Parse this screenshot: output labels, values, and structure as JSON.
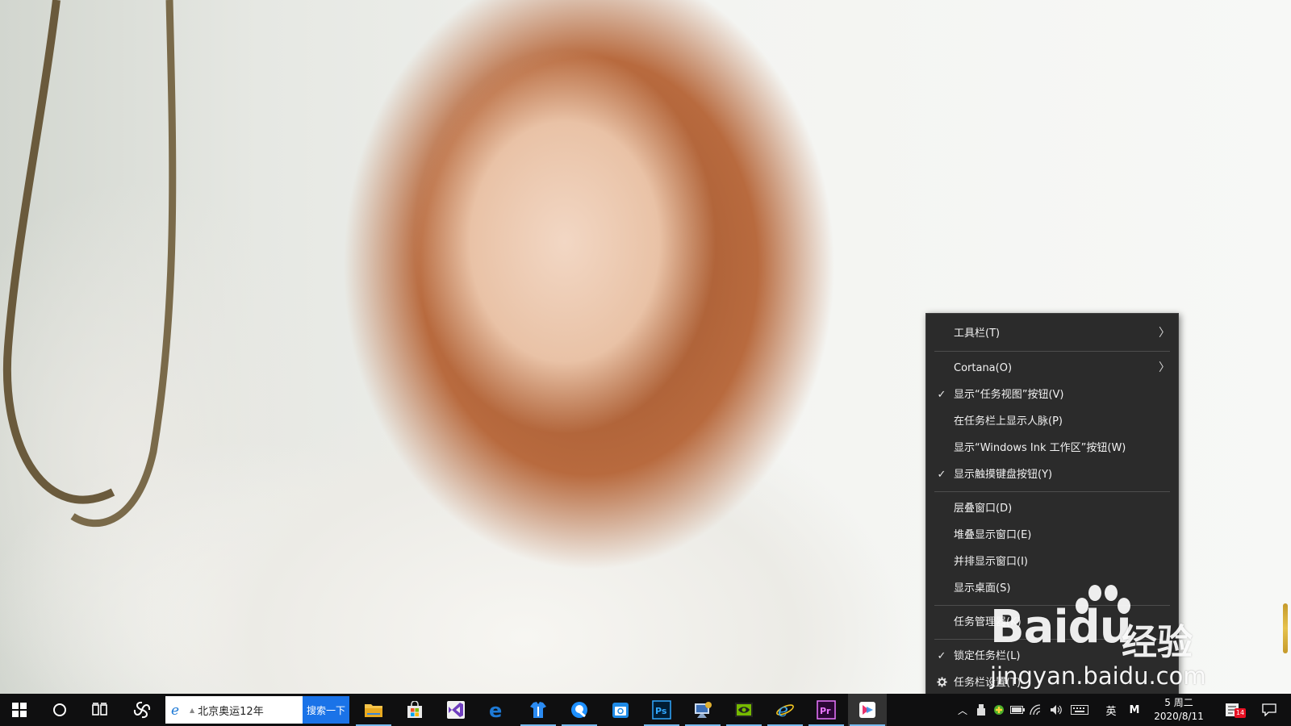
{
  "context_menu": {
    "items": [
      {
        "label": "工具栏(T)",
        "checked": false,
        "submenu": true
      },
      {
        "label": "Cortana(O)",
        "checked": false,
        "submenu": true
      },
      {
        "label": "显示“任务视图”按钮(V)",
        "checked": true,
        "submenu": false
      },
      {
        "label": "在任务栏上显示人脉(P)",
        "checked": false,
        "submenu": false
      },
      {
        "label": "显示“Windows Ink 工作区”按钮(W)",
        "checked": false,
        "submenu": false
      },
      {
        "label": "显示触摸键盘按钮(Y)",
        "checked": true,
        "submenu": false
      },
      {
        "label": "层叠窗口(D)",
        "checked": false,
        "submenu": false
      },
      {
        "label": "堆叠显示窗口(E)",
        "checked": false,
        "submenu": false
      },
      {
        "label": "并排显示窗口(I)",
        "checked": false,
        "submenu": false
      },
      {
        "label": "显示桌面(S)",
        "checked": false,
        "submenu": false
      },
      {
        "label": "任务管理器(K)",
        "checked": false,
        "submenu": false
      },
      {
        "label": "锁定任务栏(L)",
        "checked": true,
        "submenu": false
      },
      {
        "label": "任务栏设置(T)",
        "checked": false,
        "submenu": false,
        "icon": "gear-icon"
      }
    ],
    "check_glyph": "✓",
    "arrow_glyph": "〉"
  },
  "taskbar": {
    "search_text": "北京奥运12年",
    "search_button": "搜索一下",
    "tray": {
      "ime_language": "英",
      "ime_mode": "M",
      "time_fragment": "5 周二",
      "date": "2020/8/11",
      "notification_count": "14"
    },
    "apps": [
      {
        "name": "file-explorer-icon"
      },
      {
        "name": "store-icon"
      },
      {
        "name": "visual-studio-icon"
      },
      {
        "name": "edge-icon"
      },
      {
        "name": "app-shirt-icon"
      },
      {
        "name": "app-q-icon"
      },
      {
        "name": "app-calendar-icon"
      },
      {
        "name": "photoshop-icon",
        "label": "Ps"
      },
      {
        "name": "app-blue-icon"
      },
      {
        "name": "nvidia-icon"
      },
      {
        "name": "ie-icon"
      },
      {
        "name": "premiere-icon",
        "label": "Pr"
      },
      {
        "name": "app-pink-icon"
      }
    ]
  },
  "watermark": {
    "brand": "Bai",
    "brand_suffix": "du",
    "product": "经验",
    "url": "jingyan.baidu.com"
  },
  "colors": {
    "menu_bg": "#2b2b2b",
    "taskbar_bg": "#0f0f10",
    "accent": "#1a73e8"
  }
}
